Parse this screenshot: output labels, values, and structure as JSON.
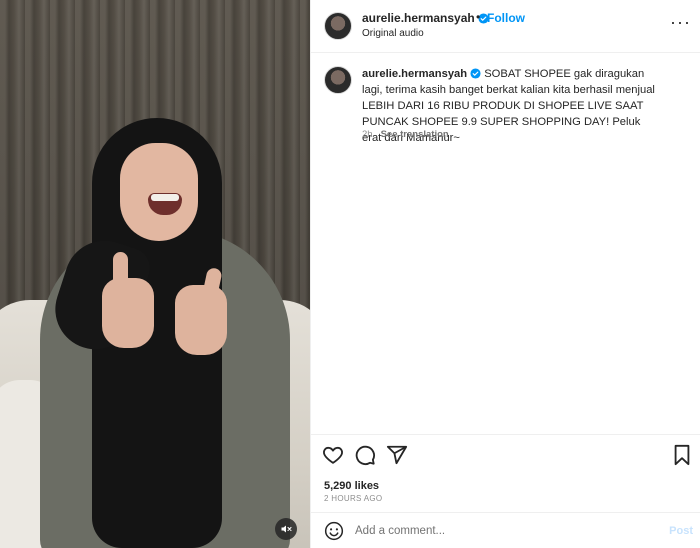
{
  "header": {
    "username": "aurelie.hermansyah",
    "separator": "•",
    "follow_label": "Follow",
    "audio_label": "Original audio",
    "more_label": "···"
  },
  "caption": {
    "username": "aurelie.hermansyah",
    "text": "SOBAT SHOPEE gak diragukan lagi, terima kasih banget berkat kalian kita berhasil menjual LEBIH DARI 16 RIBU PRODUK DI SHOPEE LIVE SAAT PUNCAK SHOPEE 9.9 SUPER SHOPPING DAY! Peluk erat dari Mamanur~",
    "age": "2h",
    "translate_label": "See translation"
  },
  "actions": {
    "likes": "5,290 likes",
    "timestamp": "2 HOURS AGO"
  },
  "comment": {
    "placeholder": "Add a comment...",
    "post_label": "Post"
  },
  "colors": {
    "accent": "#0095f6",
    "verified": "#0095f6",
    "text": "#262626",
    "muted": "#8e8e8e"
  },
  "icons": [
    "verified-icon",
    "more-icon",
    "heart-icon",
    "comment-icon",
    "share-icon",
    "bookmark-icon",
    "emoji-icon",
    "muted-speaker-icon"
  ]
}
